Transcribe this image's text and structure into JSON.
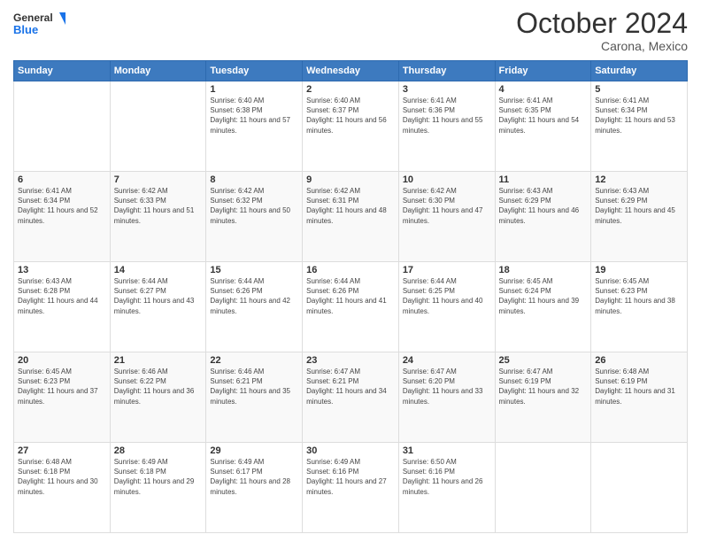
{
  "header": {
    "logo_line1": "General",
    "logo_line2": "Blue",
    "month": "October 2024",
    "location": "Carona, Mexico"
  },
  "weekdays": [
    "Sunday",
    "Monday",
    "Tuesday",
    "Wednesday",
    "Thursday",
    "Friday",
    "Saturday"
  ],
  "weeks": [
    [
      {
        "day": "",
        "info": ""
      },
      {
        "day": "",
        "info": ""
      },
      {
        "day": "1",
        "info": "Sunrise: 6:40 AM\nSunset: 6:38 PM\nDaylight: 11 hours and 57 minutes."
      },
      {
        "day": "2",
        "info": "Sunrise: 6:40 AM\nSunset: 6:37 PM\nDaylight: 11 hours and 56 minutes."
      },
      {
        "day": "3",
        "info": "Sunrise: 6:41 AM\nSunset: 6:36 PM\nDaylight: 11 hours and 55 minutes."
      },
      {
        "day": "4",
        "info": "Sunrise: 6:41 AM\nSunset: 6:35 PM\nDaylight: 11 hours and 54 minutes."
      },
      {
        "day": "5",
        "info": "Sunrise: 6:41 AM\nSunset: 6:34 PM\nDaylight: 11 hours and 53 minutes."
      }
    ],
    [
      {
        "day": "6",
        "info": "Sunrise: 6:41 AM\nSunset: 6:34 PM\nDaylight: 11 hours and 52 minutes."
      },
      {
        "day": "7",
        "info": "Sunrise: 6:42 AM\nSunset: 6:33 PM\nDaylight: 11 hours and 51 minutes."
      },
      {
        "day": "8",
        "info": "Sunrise: 6:42 AM\nSunset: 6:32 PM\nDaylight: 11 hours and 50 minutes."
      },
      {
        "day": "9",
        "info": "Sunrise: 6:42 AM\nSunset: 6:31 PM\nDaylight: 11 hours and 48 minutes."
      },
      {
        "day": "10",
        "info": "Sunrise: 6:42 AM\nSunset: 6:30 PM\nDaylight: 11 hours and 47 minutes."
      },
      {
        "day": "11",
        "info": "Sunrise: 6:43 AM\nSunset: 6:29 PM\nDaylight: 11 hours and 46 minutes."
      },
      {
        "day": "12",
        "info": "Sunrise: 6:43 AM\nSunset: 6:29 PM\nDaylight: 11 hours and 45 minutes."
      }
    ],
    [
      {
        "day": "13",
        "info": "Sunrise: 6:43 AM\nSunset: 6:28 PM\nDaylight: 11 hours and 44 minutes."
      },
      {
        "day": "14",
        "info": "Sunrise: 6:44 AM\nSunset: 6:27 PM\nDaylight: 11 hours and 43 minutes."
      },
      {
        "day": "15",
        "info": "Sunrise: 6:44 AM\nSunset: 6:26 PM\nDaylight: 11 hours and 42 minutes."
      },
      {
        "day": "16",
        "info": "Sunrise: 6:44 AM\nSunset: 6:26 PM\nDaylight: 11 hours and 41 minutes."
      },
      {
        "day": "17",
        "info": "Sunrise: 6:44 AM\nSunset: 6:25 PM\nDaylight: 11 hours and 40 minutes."
      },
      {
        "day": "18",
        "info": "Sunrise: 6:45 AM\nSunset: 6:24 PM\nDaylight: 11 hours and 39 minutes."
      },
      {
        "day": "19",
        "info": "Sunrise: 6:45 AM\nSunset: 6:23 PM\nDaylight: 11 hours and 38 minutes."
      }
    ],
    [
      {
        "day": "20",
        "info": "Sunrise: 6:45 AM\nSunset: 6:23 PM\nDaylight: 11 hours and 37 minutes."
      },
      {
        "day": "21",
        "info": "Sunrise: 6:46 AM\nSunset: 6:22 PM\nDaylight: 11 hours and 36 minutes."
      },
      {
        "day": "22",
        "info": "Sunrise: 6:46 AM\nSunset: 6:21 PM\nDaylight: 11 hours and 35 minutes."
      },
      {
        "day": "23",
        "info": "Sunrise: 6:47 AM\nSunset: 6:21 PM\nDaylight: 11 hours and 34 minutes."
      },
      {
        "day": "24",
        "info": "Sunrise: 6:47 AM\nSunset: 6:20 PM\nDaylight: 11 hours and 33 minutes."
      },
      {
        "day": "25",
        "info": "Sunrise: 6:47 AM\nSunset: 6:19 PM\nDaylight: 11 hours and 32 minutes."
      },
      {
        "day": "26",
        "info": "Sunrise: 6:48 AM\nSunset: 6:19 PM\nDaylight: 11 hours and 31 minutes."
      }
    ],
    [
      {
        "day": "27",
        "info": "Sunrise: 6:48 AM\nSunset: 6:18 PM\nDaylight: 11 hours and 30 minutes."
      },
      {
        "day": "28",
        "info": "Sunrise: 6:49 AM\nSunset: 6:18 PM\nDaylight: 11 hours and 29 minutes."
      },
      {
        "day": "29",
        "info": "Sunrise: 6:49 AM\nSunset: 6:17 PM\nDaylight: 11 hours and 28 minutes."
      },
      {
        "day": "30",
        "info": "Sunrise: 6:49 AM\nSunset: 6:16 PM\nDaylight: 11 hours and 27 minutes."
      },
      {
        "day": "31",
        "info": "Sunrise: 6:50 AM\nSunset: 6:16 PM\nDaylight: 11 hours and 26 minutes."
      },
      {
        "day": "",
        "info": ""
      },
      {
        "day": "",
        "info": ""
      }
    ]
  ]
}
